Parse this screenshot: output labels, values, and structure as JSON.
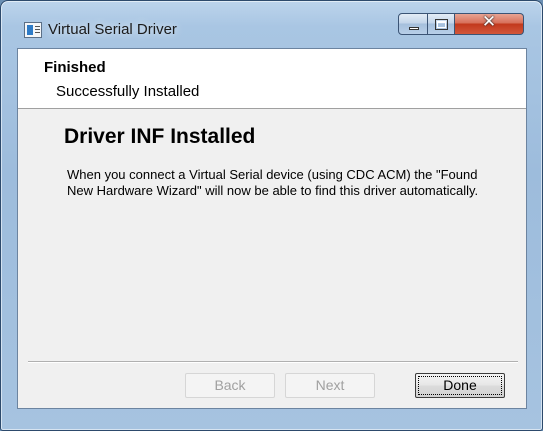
{
  "window": {
    "title": "Virtual Serial Driver",
    "icon": "app-icon"
  },
  "caption_buttons": {
    "minimize_icon": "minimize-icon",
    "maximize_icon": "maximize-icon",
    "close_glyph": "✕"
  },
  "header": {
    "title": "Finished",
    "subtitle": "Successfully Installed"
  },
  "main": {
    "title": "Driver INF Installed",
    "body": "When you connect a Virtual Serial device (using CDC ACM) the \"Found New Hardware Wizard\" will now be able to find this driver automatically."
  },
  "buttons": {
    "back": "Back",
    "next": "Next",
    "done": "Done"
  }
}
